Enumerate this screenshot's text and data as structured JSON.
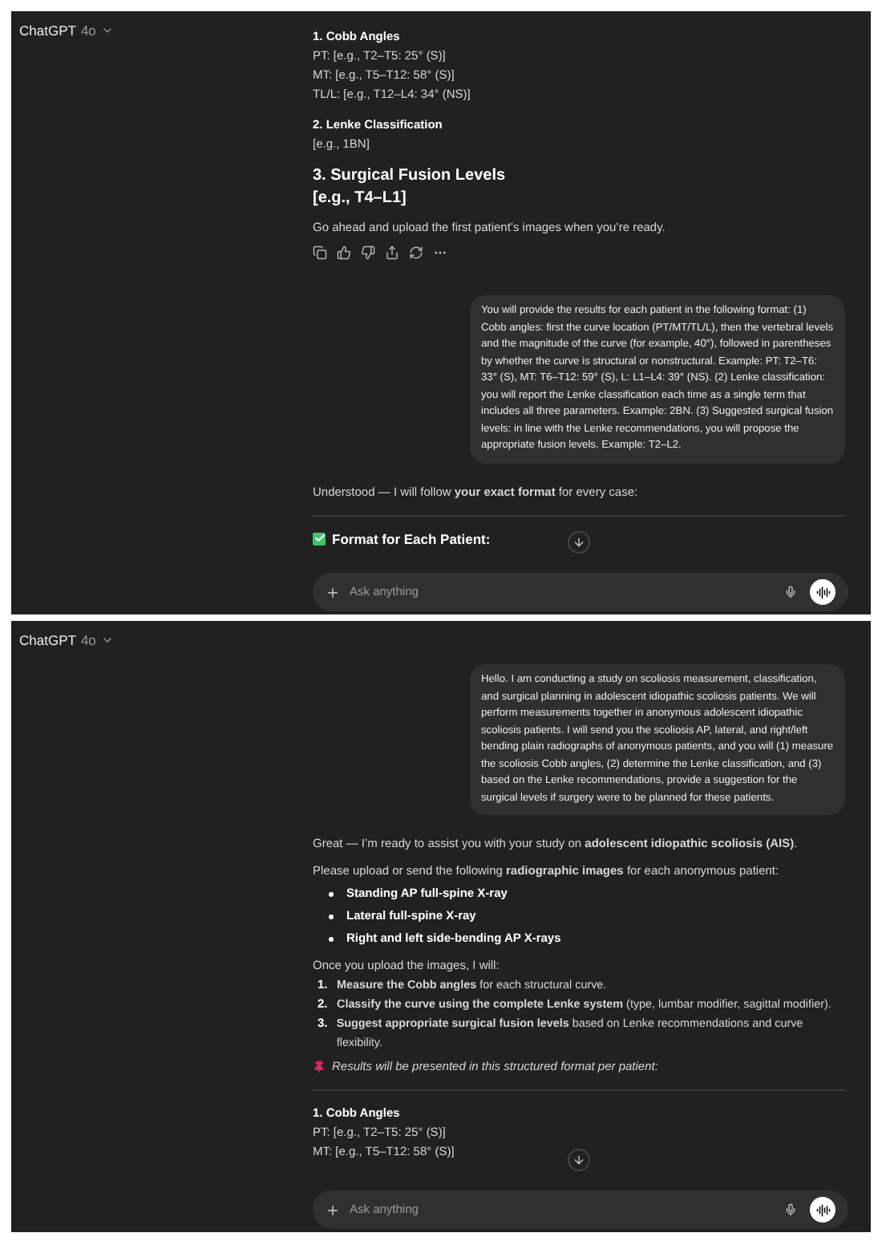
{
  "screens": [
    {
      "header": {
        "title": "ChatGPT",
        "model": "4o"
      },
      "composer": {
        "placeholder": "Ask anything"
      },
      "blocks": [
        {
          "kind": "label",
          "text": "1. Cobb Angles"
        },
        {
          "kind": "line",
          "text": "PT: [e.g., T2–T5: 25° (S)]"
        },
        {
          "kind": "line",
          "text": "MT: [e.g., T5–T12: 58° (S)]"
        },
        {
          "kind": "line",
          "text": "TL/L: [e.g., T12–L4: 34° (NS)]"
        },
        {
          "kind": "label",
          "text": "2. Lenke Classification"
        },
        {
          "kind": "line",
          "text": "[e.g., 1BN]"
        },
        {
          "kind": "title",
          "text": "3. Surgical Fusion Levels"
        },
        {
          "kind": "subtitle",
          "text": "[e.g., T4–L1]"
        },
        {
          "kind": "para",
          "text": "Go ahead and upload the first patient’s images when you’re ready."
        },
        {
          "kind": "actions"
        },
        {
          "kind": "user",
          "text": "You will provide the results for each patient in the following format: (1) Cobb angles: first the curve location (PT/MT/TL/L), then the vertebral levels and the magnitude of the curve (for example, 40°), followed in parentheses by whether the curve is structural or nonstructural. Example: PT: T2–T6: 33° (S), MT: T6–T12: 59° (S), L: L1–L4: 39° (NS). (2) Lenke classification: you will report the Lenke classification each time as a single term that includes all three parameters. Example: 2BN. (3) Suggested surgical fusion levels: in line with the Lenke recommendations, you will propose the appropriate fusion levels. Example: T2–L2."
        },
        {
          "kind": "para",
          "text": "Understood — I will follow **your exact format** for every case:"
        },
        {
          "kind": "rule"
        },
        {
          "kind": "task",
          "text": "Format for Each Patient:",
          "checked": true
        }
      ]
    },
    {
      "header": {
        "title": "ChatGPT",
        "model": "4o"
      },
      "composer": {
        "placeholder": "Ask anything"
      },
      "blocks": [
        {
          "kind": "user",
          "text": "Hello. I am conducting a study on scoliosis measurement, classification, and surgical planning in adolescent idiopathic scoliosis patients. We will perform measurements together in anonymous adolescent idiopathic scoliosis patients. I will send you the scoliosis AP, lateral, and right/left bending plain radiographs of anonymous patients, and you will (1) measure the scoliosis Cobb angles, (2) determine the Lenke classification, and (3) based on the Lenke recommendations, provide a suggestion for the surgical levels if surgery were to be planned for these patients."
        },
        {
          "kind": "para",
          "text": "Great — I’m ready to assist you with your study on **adolescent idiopathic scoliosis (AIS)**."
        },
        {
          "kind": "para",
          "text": "Please upload or send the following **radiographic images** for each anonymous patient:"
        },
        {
          "kind": "bullet",
          "text": "Standing AP full-spine X-ray"
        },
        {
          "kind": "bullet",
          "text": "Lateral full-spine X-ray"
        },
        {
          "kind": "bullet",
          "text": "Right and left side-bending AP X-rays"
        },
        {
          "kind": "para",
          "text": "Once you upload the images, I will:"
        },
        {
          "kind": "step",
          "number": "1.",
          "text": "**Measure the Cobb angles** for each structural curve."
        },
        {
          "kind": "step",
          "number": "2.",
          "text": "**Classify the curve using the complete Lenke system** (type, lumbar modifier, sagittal modifier)."
        },
        {
          "kind": "step",
          "number": "3.",
          "text": "**Suggest appropriate surgical fusion levels** based on Lenke recommendations and curve flexibility."
        },
        {
          "kind": "note",
          "text": "Results will be presented in this structured format per patient:"
        },
        {
          "kind": "rule"
        },
        {
          "kind": "label",
          "text": "1. Cobb Angles"
        },
        {
          "kind": "line",
          "text": "PT: [e.g., T2–T5: 25° (S)]"
        },
        {
          "kind": "line",
          "text": "MT: [e.g., T5–T12: 58° (S)]"
        }
      ]
    }
  ]
}
